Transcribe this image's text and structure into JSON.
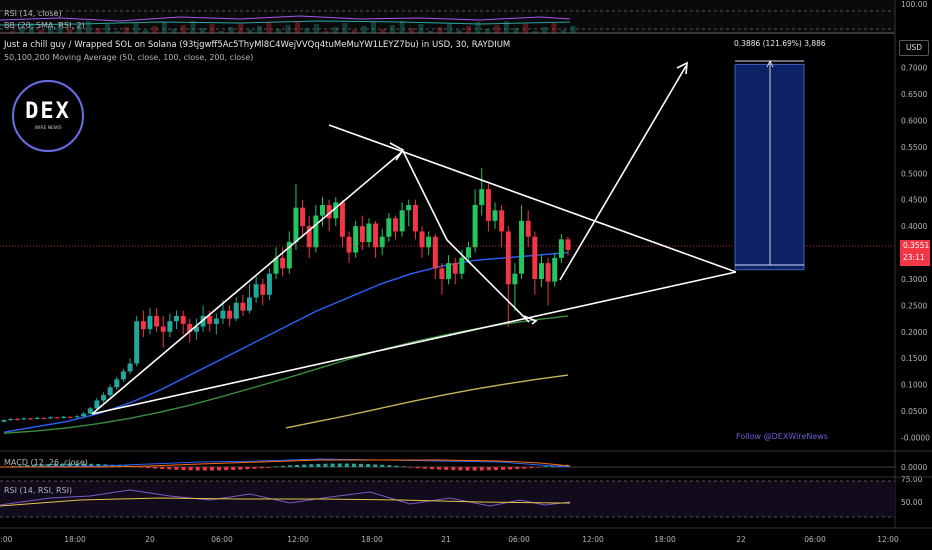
{
  "header": {
    "title": "Just a chill guy / Wrapped SOL on Solana (93tjgwff5Ac5ThyMl8C4WejVVQq4tuMeMuYW1LEYZ7bu) in USD, 30, RAYDIUM",
    "ma_label": "50,100,200 Moving Average (50, close, 100, close, 200, close)",
    "rsi_top_label": "RSI (14, close)",
    "bb_top_label": "BB (20, SMA, RSI, 2)",
    "currency_button": "USD"
  },
  "logo": {
    "text": "DEX",
    "sub": "WIRE NEWS"
  },
  "position_label": "0.3886 (121.69%) 3,886",
  "footer_text": "Follow @DEXWireNews",
  "price_badge": {
    "price": "0.3551",
    "countdown": "23:11"
  },
  "panes": {
    "macd_label": "MACD (12, 26, close)",
    "rsi_label": "RSI (14, RSI, RSI)"
  },
  "colors": {
    "up": "#26a69a",
    "up_bright": "#22c55e",
    "down": "#f23645",
    "ma50": "#2962ff",
    "ma100": "#388e3c",
    "ma200": "#c9b458",
    "position_fill": "#0d2366",
    "position_border": "#3f5fb8"
  },
  "chart_data": {
    "type": "candlestick",
    "ylim": [
      -0.02,
      0.76
    ],
    "y_ticks": [
      "0.7000",
      "0.6500",
      "0.6000",
      "0.5500",
      "0.5000",
      "0.4500",
      "0.4000",
      "0.3500",
      "0.3000",
      "0.2500",
      "0.2000",
      "0.1500",
      "0.1000",
      "0.0500",
      "-0.0000"
    ],
    "y_tick_values": [
      0.7,
      0.65,
      0.6,
      0.55,
      0.5,
      0.45,
      0.4,
      0.35,
      0.3,
      0.25,
      0.2,
      0.15,
      0.1,
      0.05,
      0.0
    ],
    "x_ticks": [
      "2:00",
      "18:00",
      "20",
      "06:00",
      "12:00",
      "18:00",
      "21",
      "06:00",
      "12:00",
      "18:00",
      "22",
      "06:00",
      "12:00"
    ],
    "last_price": 0.3551,
    "candles": [
      [
        0.03,
        0.033,
        0.028,
        0.034
      ],
      [
        0.033,
        0.035,
        0.031,
        0.036
      ],
      [
        0.035,
        0.034,
        0.032,
        0.037
      ],
      [
        0.034,
        0.036,
        0.033,
        0.038
      ],
      [
        0.036,
        0.035,
        0.033,
        0.037
      ],
      [
        0.035,
        0.037,
        0.034,
        0.039
      ],
      [
        0.037,
        0.036,
        0.034,
        0.038
      ],
      [
        0.036,
        0.038,
        0.035,
        0.04
      ],
      [
        0.038,
        0.037,
        0.035,
        0.039
      ],
      [
        0.037,
        0.039,
        0.036,
        0.041
      ],
      [
        0.039,
        0.038,
        0.036,
        0.04
      ],
      [
        0.038,
        0.04,
        0.037,
        0.042
      ],
      [
        0.04,
        0.045,
        0.038,
        0.048
      ],
      [
        0.045,
        0.055,
        0.044,
        0.058
      ],
      [
        0.055,
        0.07,
        0.052,
        0.075
      ],
      [
        0.07,
        0.08,
        0.066,
        0.085
      ],
      [
        0.08,
        0.095,
        0.077,
        0.1
      ],
      [
        0.095,
        0.11,
        0.09,
        0.115
      ],
      [
        0.11,
        0.125,
        0.105,
        0.13
      ],
      [
        0.125,
        0.14,
        0.12,
        0.15
      ],
      [
        0.14,
        0.22,
        0.135,
        0.23
      ],
      [
        0.22,
        0.205,
        0.19,
        0.24
      ],
      [
        0.205,
        0.23,
        0.195,
        0.245
      ],
      [
        0.23,
        0.21,
        0.2,
        0.245
      ],
      [
        0.21,
        0.2,
        0.17,
        0.23
      ],
      [
        0.2,
        0.22,
        0.19,
        0.235
      ],
      [
        0.22,
        0.23,
        0.205,
        0.24
      ],
      [
        0.23,
        0.215,
        0.195,
        0.24
      ],
      [
        0.215,
        0.2,
        0.18,
        0.225
      ],
      [
        0.2,
        0.21,
        0.185,
        0.225
      ],
      [
        0.21,
        0.23,
        0.2,
        0.25
      ],
      [
        0.23,
        0.215,
        0.2,
        0.24
      ],
      [
        0.215,
        0.225,
        0.195,
        0.235
      ],
      [
        0.225,
        0.24,
        0.215,
        0.26
      ],
      [
        0.24,
        0.225,
        0.21,
        0.25
      ],
      [
        0.225,
        0.255,
        0.22,
        0.265
      ],
      [
        0.255,
        0.24,
        0.23,
        0.27
      ],
      [
        0.24,
        0.265,
        0.235,
        0.29
      ],
      [
        0.265,
        0.29,
        0.255,
        0.305
      ],
      [
        0.29,
        0.27,
        0.25,
        0.3
      ],
      [
        0.27,
        0.31,
        0.26,
        0.32
      ],
      [
        0.31,
        0.34,
        0.3,
        0.36
      ],
      [
        0.34,
        0.32,
        0.305,
        0.36
      ],
      [
        0.32,
        0.37,
        0.31,
        0.39
      ],
      [
        0.37,
        0.435,
        0.355,
        0.48
      ],
      [
        0.435,
        0.4,
        0.38,
        0.45
      ],
      [
        0.4,
        0.36,
        0.34,
        0.42
      ],
      [
        0.36,
        0.42,
        0.35,
        0.44
      ],
      [
        0.42,
        0.44,
        0.4,
        0.455
      ],
      [
        0.44,
        0.415,
        0.39,
        0.45
      ],
      [
        0.415,
        0.445,
        0.4,
        0.455
      ],
      [
        0.445,
        0.38,
        0.36,
        0.45
      ],
      [
        0.38,
        0.35,
        0.33,
        0.39
      ],
      [
        0.35,
        0.4,
        0.34,
        0.41
      ],
      [
        0.4,
        0.37,
        0.355,
        0.42
      ],
      [
        0.37,
        0.405,
        0.36,
        0.415
      ],
      [
        0.405,
        0.36,
        0.34,
        0.41
      ],
      [
        0.36,
        0.38,
        0.345,
        0.395
      ],
      [
        0.38,
        0.415,
        0.37,
        0.425
      ],
      [
        0.415,
        0.39,
        0.375,
        0.42
      ],
      [
        0.39,
        0.43,
        0.38,
        0.445
      ],
      [
        0.43,
        0.44,
        0.4,
        0.45
      ],
      [
        0.44,
        0.39,
        0.375,
        0.45
      ],
      [
        0.39,
        0.36,
        0.34,
        0.4
      ],
      [
        0.36,
        0.38,
        0.345,
        0.39
      ],
      [
        0.38,
        0.32,
        0.3,
        0.385
      ],
      [
        0.32,
        0.3,
        0.27,
        0.33
      ],
      [
        0.3,
        0.33,
        0.29,
        0.345
      ],
      [
        0.33,
        0.31,
        0.29,
        0.34
      ],
      [
        0.31,
        0.34,
        0.3,
        0.355
      ],
      [
        0.34,
        0.36,
        0.33,
        0.37
      ],
      [
        0.36,
        0.44,
        0.35,
        0.47
      ],
      [
        0.44,
        0.47,
        0.42,
        0.51
      ],
      [
        0.47,
        0.41,
        0.39,
        0.48
      ],
      [
        0.41,
        0.43,
        0.395,
        0.445
      ],
      [
        0.43,
        0.39,
        0.36,
        0.44
      ],
      [
        0.39,
        0.29,
        0.21,
        0.4
      ],
      [
        0.29,
        0.31,
        0.24,
        0.33
      ],
      [
        0.31,
        0.41,
        0.3,
        0.44
      ],
      [
        0.41,
        0.38,
        0.36,
        0.43
      ],
      [
        0.38,
        0.3,
        0.27,
        0.39
      ],
      [
        0.3,
        0.33,
        0.285,
        0.345
      ],
      [
        0.33,
        0.295,
        0.25,
        0.34
      ],
      [
        0.295,
        0.34,
        0.285,
        0.35
      ],
      [
        0.34,
        0.375,
        0.33,
        0.385
      ],
      [
        0.375,
        0.355,
        0.345,
        0.38
      ]
    ],
    "moving_averages": [
      {
        "label": "50",
        "values": [
          0.01,
          0.02,
          0.03,
          0.045,
          0.065,
          0.09,
          0.12,
          0.15,
          0.18,
          0.21,
          0.24,
          0.265,
          0.29,
          0.31,
          0.325,
          0.335,
          0.34,
          0.345,
          0.35
        ]
      },
      {
        "label": "100",
        "values": [
          0.008,
          0.012,
          0.018,
          0.026,
          0.036,
          0.048,
          0.062,
          0.078,
          0.095,
          0.112,
          0.13,
          0.148,
          0.165,
          0.18,
          0.193,
          0.205,
          0.215,
          0.223,
          0.23
        ]
      },
      {
        "label": "200",
        "values": [
          0.0,
          0.0,
          0.0,
          0.0,
          0.0,
          0.0,
          0.0,
          0.0,
          0.0,
          0.018,
          0.03,
          0.042,
          0.055,
          0.068,
          0.08,
          0.091,
          0.101,
          0.11,
          0.118
        ]
      }
    ],
    "position": {
      "profit_pct": "121.69%",
      "from": 0.3176,
      "to": 0.7062
    }
  }
}
